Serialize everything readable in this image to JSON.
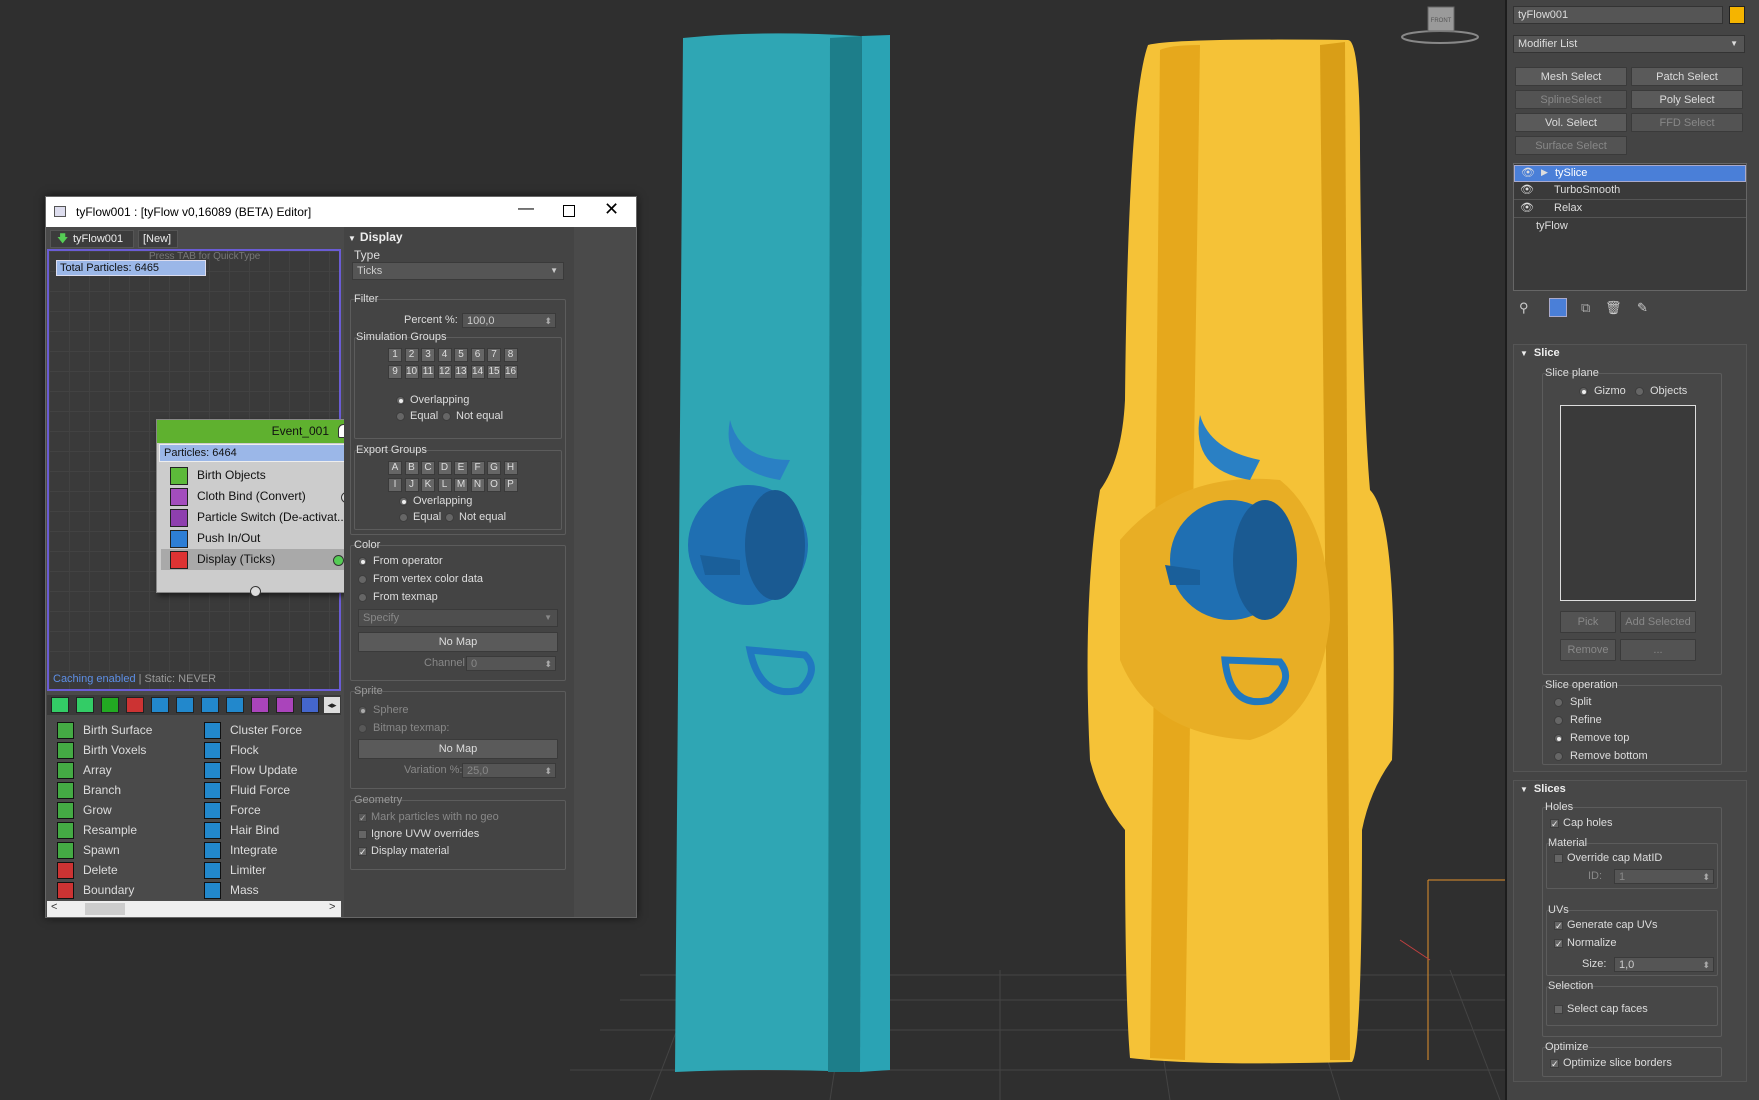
{
  "viewport": {
    "gizmo_label": "FRONT"
  },
  "cmd": {
    "object_name": "tyFlow001",
    "object_color": "#f5b400",
    "modifier_list": "Modifier List",
    "buttons": [
      "Mesh Select",
      "Patch Select",
      "SplineSelect",
      "Poly Select",
      "Vol. Select",
      "FFD Select",
      "Surface Select"
    ],
    "stack": [
      "tySlice",
      "TurboSmooth",
      "Relax",
      "tyFlow"
    ],
    "slice": {
      "title": "Slice",
      "plane_label": "Slice plane",
      "gizmo": "Gizmo",
      "objects": "Objects",
      "pick": "Pick",
      "add_selected": "Add Selected",
      "remove": "Remove",
      "ellipsis": "...",
      "op_label": "Slice operation",
      "ops": [
        "Split",
        "Refine",
        "Remove top",
        "Remove bottom"
      ]
    },
    "slices": {
      "title": "Slices",
      "holes": "Holes",
      "cap_holes": "Cap holes",
      "material": "Material",
      "override": "Override cap MatID",
      "id_label": "ID:",
      "id_value": "1",
      "uvs": "UVs",
      "gen_uvs": "Generate cap UVs",
      "normalize": "Normalize",
      "size_label": "Size:",
      "size_value": "1,0",
      "selection": "Selection",
      "select_cap": "Select cap faces",
      "optimize": "Optimize",
      "optimize_borders": "Optimize slice borders"
    }
  },
  "editor": {
    "title": "tyFlow001 : [tyFlow v0,16089 (BETA) Editor]",
    "tab_main": "tyFlow001",
    "tab_new": "[New]",
    "hint": "Press TAB for QuickType",
    "total": "Total Particles: 6465",
    "event_name": "Event_001",
    "event_particles": "Particles: 6464",
    "operators": [
      "Birth Objects",
      "Cloth Bind (Convert)",
      "Particle Switch (De-activat...",
      "Push In/Out",
      "Display (Ticks)"
    ],
    "caching": "Caching enabled",
    "static": " | Static: NEVER",
    "lib_col1": [
      "Birth Surface",
      "Birth Voxels",
      "Array",
      "Branch",
      "Grow",
      "Resample",
      "Spawn",
      "Delete",
      "Boundary"
    ],
    "lib_col2": [
      "Cluster Force",
      "Flock",
      "Flow Update",
      "Fluid Force",
      "Force",
      "Hair Bind",
      "Integrate",
      "Limiter",
      "Mass"
    ]
  },
  "display": {
    "title": "Display",
    "type_label": "Type",
    "type_value": "Ticks",
    "filter": "Filter",
    "percent_label": "Percent %:",
    "percent_value": "100,0",
    "sim_groups": "Simulation Groups",
    "nums1": [
      "1",
      "2",
      "3",
      "4",
      "5",
      "6",
      "7",
      "8"
    ],
    "nums2": [
      "9",
      "10",
      "11",
      "12",
      "13",
      "14",
      "15",
      "16"
    ],
    "overlapping": "Overlapping",
    "equal": "Equal",
    "not_equal": "Not equal",
    "export_groups": "Export Groups",
    "letters1": [
      "A",
      "B",
      "C",
      "D",
      "E",
      "F",
      "G",
      "H"
    ],
    "letters2": [
      "I",
      "J",
      "K",
      "L",
      "M",
      "N",
      "O",
      "P"
    ],
    "color": "Color",
    "from_operator": "From operator",
    "from_vertex": "From vertex color data",
    "from_texmap": "From texmap",
    "specify": "Specify",
    "no_map": "No Map",
    "channel_label": "Channel:",
    "channel_value": "0",
    "sprite": "Sprite",
    "sphere": "Sphere",
    "bitmap": "Bitmap texmap:",
    "variation_label": "Variation %:",
    "variation_value": "25,0",
    "geometry": "Geometry",
    "mark": "Mark particles with no geo",
    "ignore": "Ignore UVW overrides",
    "display_material": "Display material"
  }
}
